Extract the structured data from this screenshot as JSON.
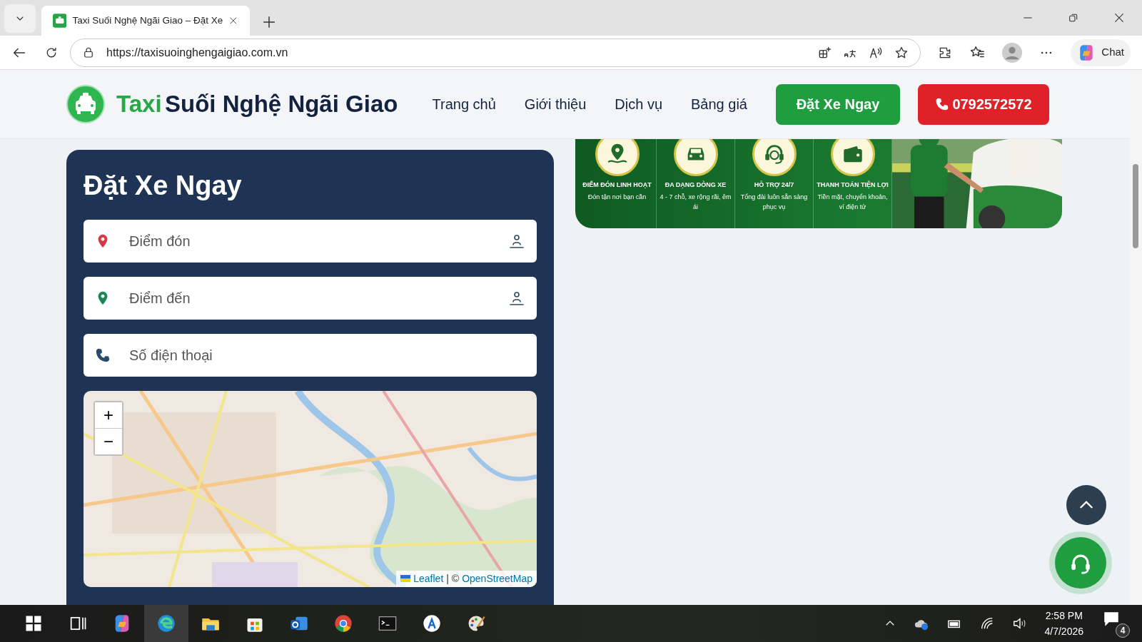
{
  "browser": {
    "tab_title": "Taxi Suối Nghệ Ngãi Giao – Đặt Xe",
    "url": "https://taxisuoinghengaigiao.com.vn",
    "chat_label": "Chat"
  },
  "navbar": {
    "brand_highlight": "Taxi",
    "brand_rest": "Suối Nghệ Ngãi Giao",
    "links": [
      "Trang chủ",
      "Giới thiệu",
      "Dịch vụ",
      "Bảng giá"
    ],
    "book_button": "Đặt Xe Ngay",
    "phone_button": "0792572572"
  },
  "booking_form": {
    "title": "Đặt Xe Ngay",
    "fields": [
      {
        "kind": "location",
        "placeholder": "Điểm đón",
        "color": "#dc3545"
      },
      {
        "kind": "location",
        "placeholder": "Điểm đến",
        "color": "#198754"
      },
      {
        "kind": "phone",
        "placeholder": "Số điện thoại"
      }
    ],
    "map": {
      "zoom_in": "+",
      "zoom_out": "−",
      "attribution_lib": "Leaflet",
      "attribution_sep": "| ©",
      "attribution_source": "OpenStreetMap"
    }
  },
  "banner": {
    "features": [
      {
        "kind": "pin",
        "title": "ĐIỂM ĐÓN LINH HOẠT",
        "text": "Đón tận nơi bạn cần"
      },
      {
        "kind": "car",
        "title": "ĐA DẠNG DÒNG XE",
        "text": "4 - 7 chỗ, xe rộng rãi, êm ái"
      },
      {
        "kind": "support",
        "title": "HỖ TRỢ 24/7",
        "text": "Tổng đài luôn sẵn sàng phục vụ"
      },
      {
        "kind": "wallet",
        "title": "THANH TOÁN TIỆN LỢI",
        "text": "Tiền mặt, chuyển khoản, ví điện tử"
      }
    ]
  },
  "taskbar": {
    "time": "2:58 PM",
    "date": "4/7/2026",
    "notifications": "4"
  }
}
